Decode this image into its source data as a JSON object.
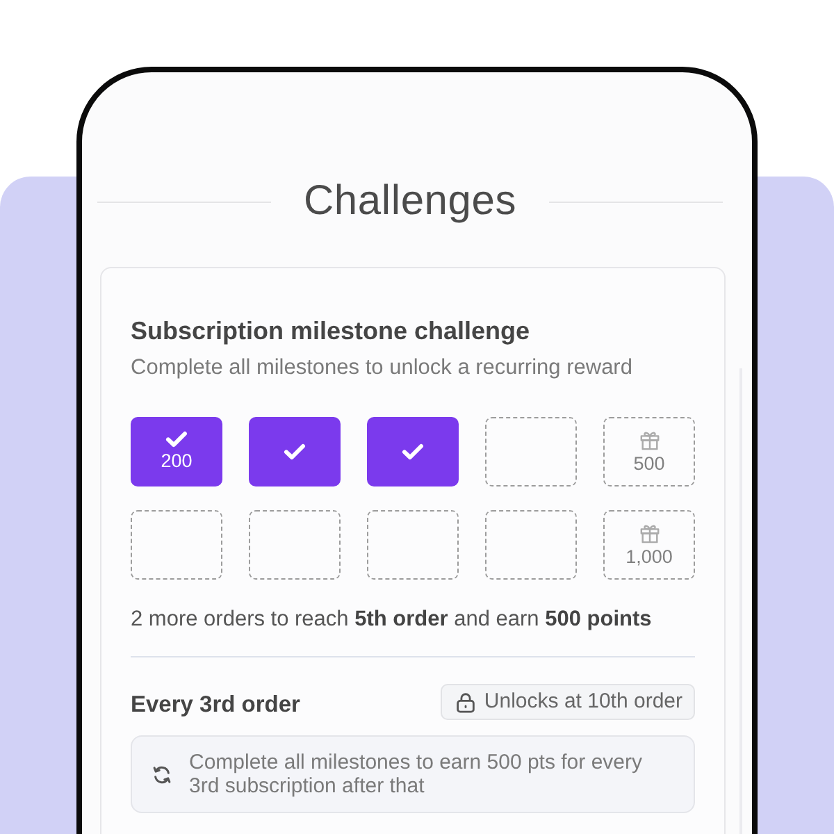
{
  "title": "Challenges",
  "challenge": {
    "title": "Subscription milestone challenge",
    "subtitle": "Complete all milestones to unlock a recurring reward",
    "milestones": [
      {
        "completed": true,
        "reward": "200"
      },
      {
        "completed": true
      },
      {
        "completed": true
      },
      {
        "completed": false
      },
      {
        "completed": false,
        "reward": "500"
      },
      {
        "completed": false
      },
      {
        "completed": false
      },
      {
        "completed": false
      },
      {
        "completed": false
      },
      {
        "completed": false,
        "reward": "1,000"
      }
    ],
    "progress_text": "2 more orders to reach **5th order** and earn **500 points**"
  },
  "recurring": {
    "title": "Every 3rd order",
    "badge": "Unlocks at 10th order",
    "note": "Complete all milestones to earn 500 pts for every 3rd subscription after that"
  }
}
